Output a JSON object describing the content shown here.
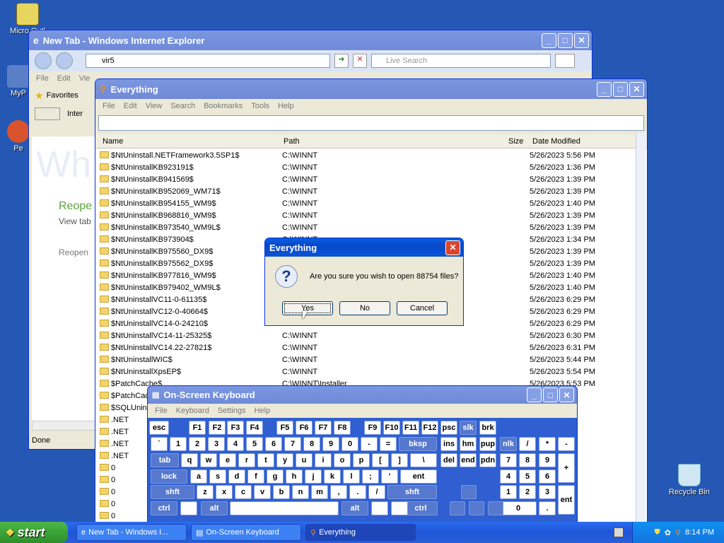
{
  "desktop": {
    "icons": [
      {
        "label": "Micro Outl"
      },
      {
        "label": "MyP"
      },
      {
        "label": "Pe"
      },
      {
        "label": "Recycle Bin"
      }
    ]
  },
  "ie": {
    "title": "New Tab - Windows Internet Explorer",
    "address": "vir5",
    "search_placeholder": "Live Search",
    "menu": [
      "File",
      "Edit",
      "Vie"
    ],
    "favorites": "Favorites",
    "tab": "Inter",
    "watermark": "Wh",
    "reopen": "Reope",
    "viewtab": "View tab",
    "reopen2": "Reopen",
    "status": "Done"
  },
  "everything": {
    "title": "Everything",
    "menu": [
      "File",
      "Edit",
      "View",
      "Search",
      "Bookmarks",
      "Tools",
      "Help"
    ],
    "columns": {
      "name": "Name",
      "path": "Path",
      "size": "Size",
      "date": "Date Modified"
    },
    "rows": [
      {
        "name": "$NtUninstall.NETFramework3.5SP1$",
        "path": "C:\\WINNT",
        "date": "5/26/2023 5:56 PM"
      },
      {
        "name": "$NtUninstallKB923191$",
        "path": "C:\\WINNT",
        "date": "5/26/2023 1:36 PM"
      },
      {
        "name": "$NtUninstallKB941569$",
        "path": "C:\\WINNT",
        "date": "5/26/2023 1:39 PM"
      },
      {
        "name": "$NtUninstallKB952069_WM71$",
        "path": "C:\\WINNT",
        "date": "5/26/2023 1:39 PM"
      },
      {
        "name": "$NtUninstallKB954155_WM9$",
        "path": "C:\\WINNT",
        "date": "5/26/2023 1:40 PM"
      },
      {
        "name": "$NtUninstallKB968816_WM9$",
        "path": "C:\\WINNT",
        "date": "5/26/2023 1:39 PM"
      },
      {
        "name": "$NtUninstallKB973540_WM9L$",
        "path": "C:\\WINNT",
        "date": "5/26/2023 1:39 PM"
      },
      {
        "name": "$NtUninstallKB973904$",
        "path": "C:\\WINNT",
        "date": "5/26/2023 1:34 PM"
      },
      {
        "name": "$NtUninstallKB975560_DX9$",
        "path": "",
        "date": "5/26/2023 1:39 PM"
      },
      {
        "name": "$NtUninstallKB975562_DX9$",
        "path": "",
        "date": "5/26/2023 1:39 PM"
      },
      {
        "name": "$NtUninstallKB977816_WM9$",
        "path": "",
        "date": "5/26/2023 1:40 PM"
      },
      {
        "name": "$NtUninstallKB979402_WM9L$",
        "path": "",
        "date": "5/26/2023 1:40 PM"
      },
      {
        "name": "$NtUninstallVC11-0-61135$",
        "path": "",
        "date": "5/26/2023 6:29 PM"
      },
      {
        "name": "$NtUninstallVC12-0-40664$",
        "path": "",
        "date": "5/26/2023 6:29 PM"
      },
      {
        "name": "$NtUninstallVC14-0-24210$",
        "path": "",
        "date": "5/26/2023 6:29 PM"
      },
      {
        "name": "$NtUninstallVC14-11-25325$",
        "path": "C:\\WINNT",
        "date": "5/26/2023 6:30 PM"
      },
      {
        "name": "$NtUninstallVC14.22-27821$",
        "path": "C:\\WINNT",
        "date": "5/26/2023 6:31 PM"
      },
      {
        "name": "$NtUninstallWIC$",
        "path": "C:\\WINNT",
        "date": "5/26/2023 5:44 PM"
      },
      {
        "name": "$NtUninstallXpsEP$",
        "path": "C:\\WINNT",
        "date": "5/26/2023 5:54 PM"
      },
      {
        "name": "$PatchCache$",
        "path": "C:\\WINNT\\Installer",
        "date": "5/26/2023 5:53 PM"
      },
      {
        "name": "$PatchCac",
        "path": "",
        "date": "1 PM"
      },
      {
        "name": "$SQLUnins",
        "path": "",
        "date": "4 PM"
      },
      {
        "name": ".NET",
        "path": "",
        "date": "1 PM"
      },
      {
        "name": ".NET",
        "path": "",
        "date": "1 PM"
      },
      {
        "name": ".NET",
        "path": "",
        "date": "3 PM"
      },
      {
        "name": ".NET",
        "path": "",
        "date": "3 PM"
      },
      {
        "name": "0",
        "path": "",
        "date": "0 PM"
      },
      {
        "name": "0",
        "path": "",
        "date": "28 PM"
      },
      {
        "name": "0",
        "path": "",
        "date": "6 PM"
      },
      {
        "name": "0",
        "path": "",
        "date": "1 PM"
      },
      {
        "name": "0",
        "path": "",
        "date": "1 PM"
      },
      {
        "name": "0",
        "path": "",
        "date": "2 PM"
      }
    ]
  },
  "dialog": {
    "title": "Everything",
    "message": "Are you sure you wish to open 88754 files?",
    "yes": "Yes",
    "no": "No",
    "cancel": "Cancel"
  },
  "osk": {
    "title": "On-Screen Keyboard",
    "menu": [
      "File",
      "Keyboard",
      "Settings",
      "Help"
    ],
    "keys": [
      "esc",
      "F1",
      "F2",
      "F3",
      "F4",
      "F5",
      "F6",
      "F7",
      "F8",
      "F9",
      "F10",
      "F11",
      "F12",
      "psc",
      "slk",
      "brk",
      "`",
      "1",
      "2",
      "3",
      "4",
      "5",
      "6",
      "7",
      "8",
      "9",
      "0",
      "-",
      "=",
      "bksp",
      "ins",
      "hm",
      "pup",
      "nlk",
      "/",
      "*",
      "-",
      "tab",
      "q",
      "w",
      "e",
      "r",
      "t",
      "y",
      "u",
      "i",
      "o",
      "p",
      "[",
      "]",
      "\\",
      "del",
      "end",
      "pdn",
      "7",
      "8",
      "9",
      "+",
      "lock",
      "a",
      "s",
      "d",
      "f",
      "g",
      "h",
      "j",
      "k",
      "l",
      ";",
      "'",
      "ent",
      "4",
      "5",
      "6",
      "shft",
      "z",
      "x",
      "c",
      "v",
      "b",
      "n",
      "m",
      ",",
      ".",
      "/",
      "shft",
      "1",
      "2",
      "3",
      "ent",
      "ctrl",
      "alt",
      "alt",
      "ctrl",
      "0",
      "."
    ]
  },
  "taskbar": {
    "start": "start",
    "buttons": [
      "New Tab - Windows I...",
      "On-Screen Keyboard",
      "Everything"
    ],
    "time": "8:14 PM"
  }
}
